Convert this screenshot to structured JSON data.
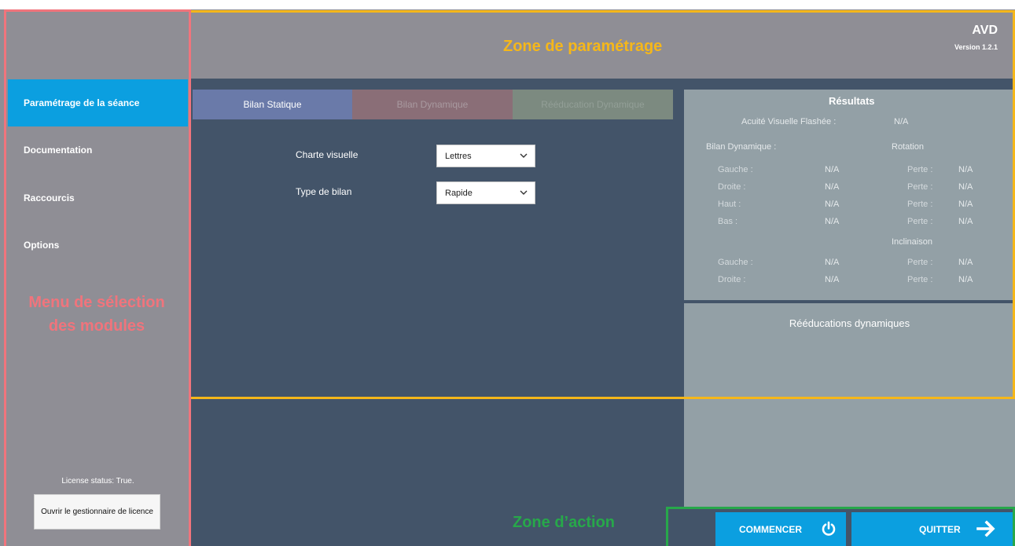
{
  "header": {
    "title": "AVD",
    "version": "Version 1.2.1"
  },
  "sidebar": {
    "items": [
      {
        "label": "Paramétrage de la séance",
        "active": true
      },
      {
        "label": "Documentation",
        "active": false
      },
      {
        "label": "Raccourcis",
        "active": false
      },
      {
        "label": "Options",
        "active": false
      }
    ],
    "license_status": "License status: True.",
    "license_button": "Ouvrir le gestionnaire de licence"
  },
  "tabs": [
    {
      "label": "Bilan Statique",
      "selected": true
    },
    {
      "label": "Bilan Dynamique",
      "selected": false
    },
    {
      "label": "Rééducation Dynamique",
      "selected": false
    }
  ],
  "form": {
    "chart_label": "Charte visuelle",
    "chart_value": "Lettres",
    "type_label": "Type de bilan",
    "type_value": "Rapide"
  },
  "results": {
    "title": "Résultats",
    "acuity_label": "Acuité Visuelle Flashée :",
    "acuity_value": "N/A",
    "dynamic_label": "Bilan Dynamique :",
    "rotation_label": "Rotation",
    "rotation_rows": [
      {
        "label": "Gauche :",
        "value": "N/A",
        "loss_label": "Perte :",
        "loss_value": "N/A"
      },
      {
        "label": "Droite :",
        "value": "N/A",
        "loss_label": "Perte :",
        "loss_value": "N/A"
      },
      {
        "label": "Haut :",
        "value": "N/A",
        "loss_label": "Perte :",
        "loss_value": "N/A"
      },
      {
        "label": "Bas :",
        "value": "N/A",
        "loss_label": "Perte :",
        "loss_value": "N/A"
      }
    ],
    "inclination_label": "Inclinaison",
    "inclination_rows": [
      {
        "label": "Gauche :",
        "value": "N/A",
        "loss_label": "Perte :",
        "loss_value": "N/A"
      },
      {
        "label": "Droite :",
        "value": "N/A",
        "loss_label": "Perte :",
        "loss_value": "N/A"
      }
    ],
    "reeducations_title": "Rééducations dynamiques"
  },
  "actions": {
    "start_label": "COMMENCER",
    "quit_label": "QUITTER"
  },
  "annotations": {
    "param_zone": "Zone de paramétrage",
    "menu_zone_line1": "Menu de sélection",
    "menu_zone_line2": "des modules",
    "action_zone": "Zone d’action"
  },
  "colors": {
    "accent": "#0b9fe0",
    "panel": "#435469",
    "gray": "#8f8e95",
    "annot_param": "#f5b71a",
    "annot_menu": "#f0747c",
    "annot_action": "#27a84a"
  }
}
